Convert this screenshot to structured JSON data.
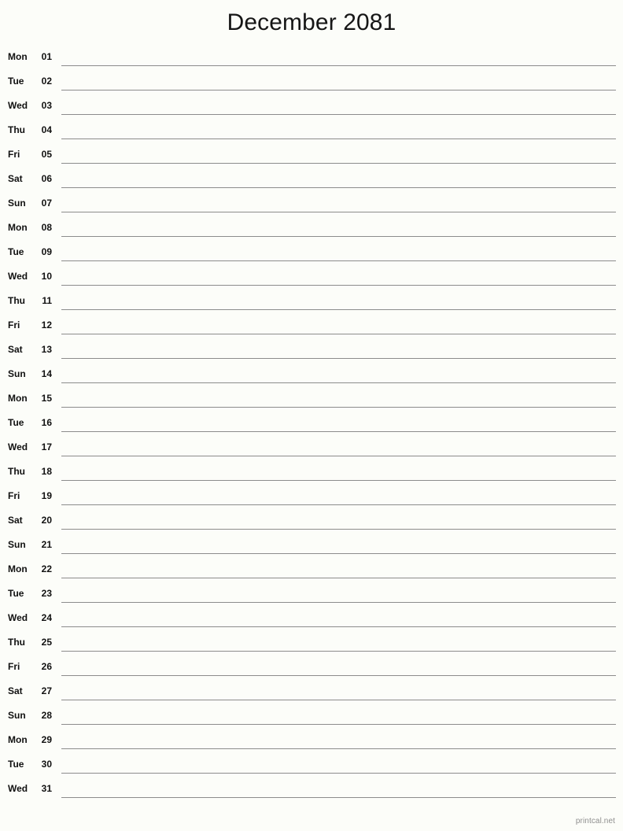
{
  "document": {
    "title": "December 2081",
    "month": "December",
    "year": "2081",
    "type": "monthly-notes-calendar"
  },
  "colors": {
    "background": "#fcfdf9",
    "text": "#141414",
    "rule": "#8c8c8c",
    "footer_text": "#8e8e8e"
  },
  "footer": {
    "brand": "printcal.net"
  },
  "days": [
    {
      "dow": "Mon",
      "num": "01"
    },
    {
      "dow": "Tue",
      "num": "02"
    },
    {
      "dow": "Wed",
      "num": "03"
    },
    {
      "dow": "Thu",
      "num": "04"
    },
    {
      "dow": "Fri",
      "num": "05"
    },
    {
      "dow": "Sat",
      "num": "06"
    },
    {
      "dow": "Sun",
      "num": "07"
    },
    {
      "dow": "Mon",
      "num": "08"
    },
    {
      "dow": "Tue",
      "num": "09"
    },
    {
      "dow": "Wed",
      "num": "10"
    },
    {
      "dow": "Thu",
      "num": "11"
    },
    {
      "dow": "Fri",
      "num": "12"
    },
    {
      "dow": "Sat",
      "num": "13"
    },
    {
      "dow": "Sun",
      "num": "14"
    },
    {
      "dow": "Mon",
      "num": "15"
    },
    {
      "dow": "Tue",
      "num": "16"
    },
    {
      "dow": "Wed",
      "num": "17"
    },
    {
      "dow": "Thu",
      "num": "18"
    },
    {
      "dow": "Fri",
      "num": "19"
    },
    {
      "dow": "Sat",
      "num": "20"
    },
    {
      "dow": "Sun",
      "num": "21"
    },
    {
      "dow": "Mon",
      "num": "22"
    },
    {
      "dow": "Tue",
      "num": "23"
    },
    {
      "dow": "Wed",
      "num": "24"
    },
    {
      "dow": "Thu",
      "num": "25"
    },
    {
      "dow": "Fri",
      "num": "26"
    },
    {
      "dow": "Sat",
      "num": "27"
    },
    {
      "dow": "Sun",
      "num": "28"
    },
    {
      "dow": "Mon",
      "num": "29"
    },
    {
      "dow": "Tue",
      "num": "30"
    },
    {
      "dow": "Wed",
      "num": "31"
    }
  ]
}
